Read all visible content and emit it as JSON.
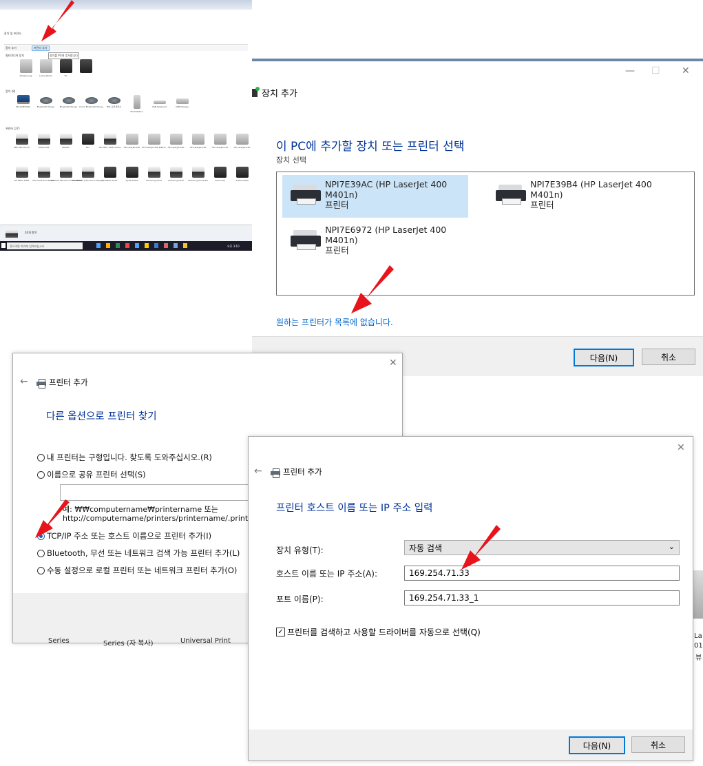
{
  "colors": {
    "arrow": "#e8141c",
    "accent": "#0078d7",
    "heading_blue": "#003399",
    "link_blue": "#0066cc"
  },
  "thumb": {
    "title": "장치 및 프린터",
    "toolbar": [
      "장치 추가",
      "프린터 추가"
    ],
    "section_multimedia": "멀티미디어 장치",
    "section_devices": "장치 (8)",
    "section_printers": "프린터 (27)",
    "tooltip": "장치를 PC에 추가합니다",
    "mm_items": [
      "W-Samsung",
      "Living Room",
      "TV"
    ],
    "dev_items": [
      "MS-SAMSUNG",
      "Bluetooth Mouse",
      "Bluetooth Mouse",
      "Como Bluetooth Mouse",
      "HID 규격 마우스",
      "WorkStation",
      "USB Keyboard",
      "USB Storage"
    ],
    "printer_row1": [
      "ABC PDF Driver",
      "Adobe PDF",
      "EPSON",
      "Fax",
      "HP ENVY 5000 series",
      "HP LaserJet 400",
      "HP LaserJet 400 M401n",
      "HP LaserJet 400",
      "HP LaserJet 400",
      "HP LaserJet 400",
      "HP LaserJet 400"
    ],
    "printer_row2": [
      "HP ENVY 5000",
      "Microsoft Print to PDF",
      "Microsoft XPS Document Writer",
      "NPI28B5A4 (HP Color LaserJet)",
      "OneNote 2013",
      "Oydai DVDa",
      "Samsung C470",
      "Samsung C470",
      "Samsung Universal",
      "Samsung",
      "X-Rite DVDa"
    ],
    "status_text": "26개 항목",
    "search_text": "찾으려면 여기에 입력하십시오",
    "clock": "오후 3:10"
  },
  "dlgA": {
    "window_title": "장치 추가",
    "heading": "이 PC에 추가할 장치 또는 프린터 선택",
    "subheading": "장치 선택",
    "devices": [
      {
        "name": "NPI7E39AC (HP LaserJet 400 M401n)",
        "type": "프린터"
      },
      {
        "name": "NPI7E39B4 (HP LaserJet 400 M401n)",
        "type": "프린터"
      },
      {
        "name": "NPI7E6972 (HP LaserJet 400 M401n)",
        "type": "프린터"
      }
    ],
    "missing_link": "원하는 프린터가 목록에 없습니다.",
    "next": "다음(N)",
    "cancel": "취소"
  },
  "dlgB": {
    "window_title": "프린터 추가",
    "heading": "다른 옵션으로 프린터 찾기",
    "options": [
      "내 프린터는 구형입니다. 찾도록 도와주십시오.(R)",
      "이름으로 공유 프린터 선택(S)",
      "TCP/IP 주소 또는 호스트 이름으로 프린터 추가(I)",
      "Bluetooth, 무선 또는 네트워크 검색 가능 프린터 추가(L)",
      "수동 설정으로 로컬 프린터 또는 네트워크 프린터 추가(O)"
    ],
    "example_line1": "예: ₩₩computername₩printername 또는",
    "example_line2": "http://computername/printers/printername/.printer",
    "bg_stub": [
      "Series",
      "Series (자 복사)",
      "Universal Print"
    ]
  },
  "dlgC": {
    "window_title": "프린터 추가",
    "heading": "프린터 호스트 이름 또는 IP 주소 입력",
    "device_type_label": "장치 유형(T):",
    "device_type_value": "자동 검색",
    "host_label": "호스트 이름 또는 IP 주소(A):",
    "host_value": "169.254.71.33",
    "port_label": "포트 이름(P):",
    "port_value": "169.254.71.33_1",
    "checkbox_label": "프린터를 검색하고 사용할 드라이버를 자동으로 선택(Q)",
    "next": "다음(N)",
    "cancel": "취소"
  },
  "edge_stub": [
    "La",
    "01",
    "뷰"
  ]
}
